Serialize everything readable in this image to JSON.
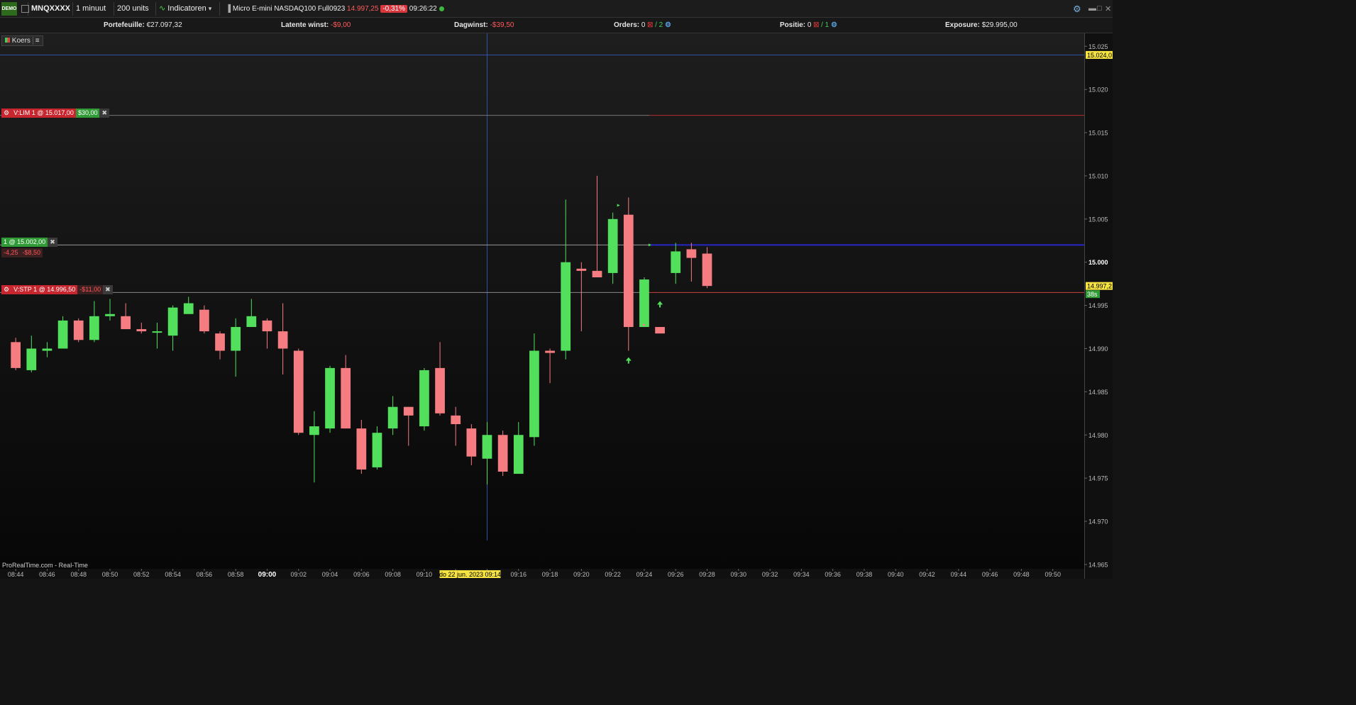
{
  "toolbar": {
    "demo_label": "DEMO",
    "symbol": "MNQXXXX",
    "interval": "1 minuut",
    "units": "200 units",
    "indicators_label": "Indicatoren",
    "instrument_name": "Micro E-mini NASDAQ100 Full0923",
    "last_price": "14.997,25",
    "change_pct": "-0,31%",
    "time": "09:26:22"
  },
  "stats": {
    "portfolio_label": "Portefeuille:",
    "portfolio_value": "€27.097,32",
    "latent_label": "Latente winst:",
    "latent_value": "-$9,00",
    "daygain_label": "Dagwinst:",
    "daygain_value": "-$39,50",
    "orders_label": "Orders:",
    "orders_value": "0",
    "orders_total": "/ 2",
    "position_label": "Positie:",
    "position_value": "0",
    "position_total": "/ 1",
    "exposure_label": "Exposure:",
    "exposure_value": "$29.995,00"
  },
  "panel": {
    "koers_label": "Koers",
    "watermark": "ProRealTime.com - Real-Time"
  },
  "orders": {
    "limit_label": "V:LIM  1 @ 15.017,00",
    "limit_gain": "$30,00",
    "position_label": "1 @ 15.002,00",
    "position_pts": "-4,25",
    "position_pl": "-$8,50",
    "stop_label": "V:STP  1 @ 14.996,50",
    "stop_loss": "-$11,00"
  },
  "axis_badges": {
    "crosshair_price": "15.024,0",
    "last_price": "14.997,2",
    "countdown": "38s",
    "crosshair_time": "do 22 jun. 2023 09:14"
  },
  "chart_data": {
    "type": "candlestick",
    "x_tick_labels": [
      "08:44",
      "08:46",
      "08:48",
      "08:50",
      "08:52",
      "08:54",
      "08:56",
      "08:58",
      "09:00",
      "09:02",
      "09:04",
      "09:06",
      "09:08",
      "09:10",
      "09:12",
      "09:14",
      "09:16",
      "09:18",
      "09:20",
      "09:22",
      "09:24",
      "09:26",
      "09:28",
      "09:30",
      "09:32",
      "09:34",
      "09:36",
      "09:38",
      "09:40",
      "09:42",
      "09:44",
      "09:46",
      "09:48",
      "09:50"
    ],
    "y_tick_labels": [
      "15.025",
      "15.020",
      "15.015",
      "15.010",
      "15.005",
      "15.000",
      "14.995",
      "14.990",
      "14.985",
      "14.980",
      "14.975",
      "14.970",
      "14.965"
    ],
    "ylim": [
      14964.5,
      15026.5
    ],
    "xlim_minutes": [
      "08:43",
      "09:52"
    ],
    "candles": [
      {
        "t": "08:44",
        "o": 14990.75,
        "h": 14991.25,
        "l": 14987.5,
        "c": 14987.75
      },
      {
        "t": "08:45",
        "o": 14987.5,
        "h": 14991.5,
        "l": 14987.25,
        "c": 14990.0
      },
      {
        "t": "08:46",
        "o": 14989.75,
        "h": 14990.75,
        "l": 14989.0,
        "c": 14990.0
      },
      {
        "t": "08:47",
        "o": 14990.0,
        "h": 14993.75,
        "l": 14990.0,
        "c": 14993.25
      },
      {
        "t": "08:48",
        "o": 14993.25,
        "h": 14993.5,
        "l": 14990.75,
        "c": 14991.0
      },
      {
        "t": "08:49",
        "o": 14991.0,
        "h": 14995.5,
        "l": 14990.75,
        "c": 14993.75
      },
      {
        "t": "08:50",
        "o": 14993.75,
        "h": 14995.75,
        "l": 14993.25,
        "c": 14994.0
      },
      {
        "t": "08:51",
        "o": 14993.75,
        "h": 14995.25,
        "l": 14992.25,
        "c": 14992.25
      },
      {
        "t": "08:52",
        "o": 14992.25,
        "h": 14993.0,
        "l": 14991.75,
        "c": 14992.0
      },
      {
        "t": "08:53",
        "o": 14992.0,
        "h": 14993.0,
        "l": 14990.0,
        "c": 14992.0
      },
      {
        "t": "08:54",
        "o": 14991.5,
        "h": 14995.0,
        "l": 14989.75,
        "c": 14994.75
      },
      {
        "t": "08:55",
        "o": 14994.0,
        "h": 14996.0,
        "l": 14994.0,
        "c": 14995.25
      },
      {
        "t": "08:56",
        "o": 14994.5,
        "h": 14995.0,
        "l": 14991.75,
        "c": 14992.0
      },
      {
        "t": "08:57",
        "o": 14991.75,
        "h": 14992.0,
        "l": 14988.75,
        "c": 14989.75
      },
      {
        "t": "08:58",
        "o": 14989.75,
        "h": 14993.5,
        "l": 14986.75,
        "c": 14992.5
      },
      {
        "t": "08:59",
        "o": 14992.5,
        "h": 14995.75,
        "l": 14992.5,
        "c": 14993.75
      },
      {
        "t": "09:00",
        "o": 14993.25,
        "h": 14993.5,
        "l": 14990.0,
        "c": 14992.0
      },
      {
        "t": "09:01",
        "o": 14992.0,
        "h": 14995.25,
        "l": 14987.0,
        "c": 14990.0
      },
      {
        "t": "09:02",
        "o": 14989.75,
        "h": 14990.0,
        "l": 14980.0,
        "c": 14980.25
      },
      {
        "t": "09:03",
        "o": 14980.0,
        "h": 14982.75,
        "l": 14974.5,
        "c": 14981.0
      },
      {
        "t": "09:04",
        "o": 14980.75,
        "h": 14988.0,
        "l": 14980.25,
        "c": 14987.75
      },
      {
        "t": "09:05",
        "o": 14987.75,
        "h": 14989.25,
        "l": 14980.75,
        "c": 14980.75
      },
      {
        "t": "09:06",
        "o": 14980.75,
        "h": 14981.75,
        "l": 14975.5,
        "c": 14976.0
      },
      {
        "t": "09:07",
        "o": 14976.25,
        "h": 14981.0,
        "l": 14976.0,
        "c": 14980.25
      },
      {
        "t": "09:08",
        "o": 14980.75,
        "h": 14984.5,
        "l": 14980.0,
        "c": 14983.25
      },
      {
        "t": "09:09",
        "o": 14983.25,
        "h": 14983.25,
        "l": 14978.75,
        "c": 14982.25
      },
      {
        "t": "09:10",
        "o": 14981.0,
        "h": 14987.75,
        "l": 14980.5,
        "c": 14987.5
      },
      {
        "t": "09:11",
        "o": 14987.75,
        "h": 14990.75,
        "l": 14982.25,
        "c": 14982.5
      },
      {
        "t": "09:12",
        "o": 14982.25,
        "h": 14983.25,
        "l": 14978.75,
        "c": 14981.25
      },
      {
        "t": "09:13",
        "o": 14980.75,
        "h": 14981.25,
        "l": 14976.5,
        "c": 14977.5
      },
      {
        "t": "09:14",
        "o": 14977.25,
        "h": 14981.5,
        "l": 14974.25,
        "c": 14980.0
      },
      {
        "t": "09:15",
        "o": 14980.0,
        "h": 14980.5,
        "l": 14975.25,
        "c": 14975.75
      },
      {
        "t": "09:16",
        "o": 14975.5,
        "h": 14981.5,
        "l": 14975.5,
        "c": 14980.0
      },
      {
        "t": "09:17",
        "o": 14979.75,
        "h": 14991.75,
        "l": 14978.75,
        "c": 14989.75
      },
      {
        "t": "09:18",
        "o": 14989.75,
        "h": 14990.0,
        "l": 14986.0,
        "c": 14989.5
      },
      {
        "t": "09:19",
        "o": 14989.75,
        "h": 15007.25,
        "l": 14988.75,
        "c": 15000.0
      },
      {
        "t": "09:20",
        "o": 14999.25,
        "h": 15000.0,
        "l": 14992.0,
        "c": 14999.0
      },
      {
        "t": "09:21",
        "o": 14999.0,
        "h": 15010.0,
        "l": 14998.25,
        "c": 14998.25
      },
      {
        "t": "09:22",
        "o": 14998.75,
        "h": 15005.75,
        "l": 14997.5,
        "c": 15005.0
      },
      {
        "t": "09:23",
        "o": 15005.5,
        "h": 15007.5,
        "l": 14989.75,
        "c": 14992.5
      },
      {
        "t": "09:24",
        "o": 14992.5,
        "h": 14998.25,
        "l": 14992.5,
        "c": 14998.0
      },
      {
        "t": "09:25",
        "o": 14992.5,
        "h": 14992.5,
        "l": 14991.75,
        "c": 14991.75
      },
      {
        "t": "09:26",
        "o": 14998.75,
        "h": 15002.25,
        "l": 14997.5,
        "c": 15001.25
      },
      {
        "t": "09:27",
        "o": 15001.5,
        "h": 15002.25,
        "l": 14997.75,
        "c": 15000.5
      },
      {
        "t": "09:28",
        "o": 15001.0,
        "h": 15001.75,
        "l": 14997.0,
        "c": 14997.25
      }
    ],
    "price_levels": {
      "limit_order": 15017.0,
      "position_entry": 15002.0,
      "stop_order": 14996.5,
      "crosshair_price": 15024.0,
      "last_price": 14997.25
    },
    "crosshair_time": "09:14"
  },
  "colors": {
    "bull": "#52e05c",
    "bear": "#f57c80",
    "position_line": "#2626c8",
    "limit_line": "#b82a2a",
    "stop_line": "#c84040",
    "crosshair": "#2f52a8"
  }
}
